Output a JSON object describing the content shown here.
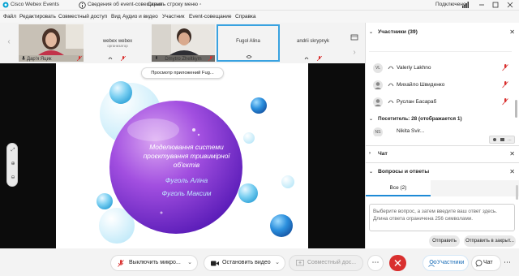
{
  "titlebar": {
    "app_title": "Cisco Webex Events",
    "info_label": "Сведения об event-совещании",
    "hide_menu_label": "Скрыть строку меню",
    "status": "Подключено"
  },
  "menu": [
    "Файл",
    "Редактировать",
    "Совместный доступ",
    "Вид",
    "Аудио и видео",
    "Участник",
    "Event-совещание",
    "Справка"
  ],
  "video_strip": {
    "tiles": [
      {
        "name": "Дар'я Яцик"
      },
      {
        "name": "webex webex",
        "sub": "организатор"
      },
      {
        "name": "Dmytro Zheltkym"
      },
      {
        "name": "Fugol Alina"
      },
      {
        "name": "andrii skrypnyk"
      }
    ]
  },
  "stage": {
    "tooltip": "Просмотр приложений Fug...",
    "slide": {
      "title_lines": [
        "Моделювання системи",
        "проєктування тривимірної",
        "об'єктів"
      ],
      "authors": [
        "Фуголь Аліна",
        "Фуголь Максим"
      ]
    }
  },
  "bottom_bar": {
    "mute": "Выключить микро...",
    "stop_video": "Остановить видео",
    "share": "Совместный дос...",
    "more": "⋯",
    "participants": "Участники",
    "chat": "Чат",
    "more_right": "⋯"
  },
  "panel": {
    "participants_header": "Участники (39)",
    "participants": [
      {
        "initials": "VL",
        "name": "Valeriy Lakhno"
      },
      {
        "initials": "",
        "name": "Михайло Швиденко"
      },
      {
        "initials": "",
        "name": "Руслан Басараб"
      }
    ],
    "attendees_header": "Посетитель: 28 (отображается 1)",
    "attendee_partial": {
      "initials": "NS",
      "name": "Nikita Svir..."
    },
    "chat_header": "Чат",
    "qa_header": "Вопросы и ответы",
    "qa_tab": "Все (2)",
    "qa_placeholder": "Выберите вопрос, а затем введите ваш ответ здесь. Длина ответа ограничена 256 символами.",
    "send_button": "Отправить",
    "send_private_button": "Отправить в закрыт..."
  },
  "colors": {
    "accent_blue": "#1d8ad6",
    "red": "#d9302f",
    "selected_tile_border": "#39a2e0"
  }
}
